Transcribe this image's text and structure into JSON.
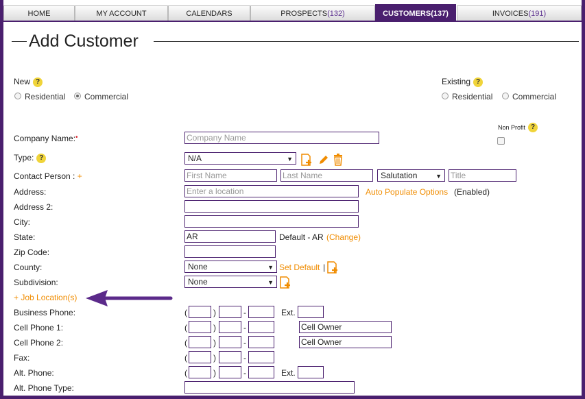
{
  "nav": {
    "tabs": [
      {
        "label": "HOME",
        "count": ""
      },
      {
        "label": "MY ACCOUNT",
        "count": ""
      },
      {
        "label": "CALENDARS",
        "count": ""
      },
      {
        "label": "PROSPECTS",
        "count": "(132)"
      },
      {
        "label": "CUSTOMERS",
        "count": "(137)"
      },
      {
        "label": "INVOICES",
        "count": "(191)"
      }
    ],
    "active": "CUSTOMERS"
  },
  "page": {
    "title": "Add Customer"
  },
  "new_group": {
    "label": "New",
    "residential": "Residential",
    "commercial": "Commercial",
    "selected": "Commercial"
  },
  "existing_group": {
    "label": "Existing",
    "residential": "Residential",
    "commercial": "Commercial"
  },
  "non_profit": {
    "label": "Non Profit"
  },
  "help_icon": "?",
  "form": {
    "company_name": {
      "label": "Company Name:",
      "placeholder": "Company Name"
    },
    "type": {
      "label": "Type:",
      "value": "N/A"
    },
    "contact": {
      "label": "Contact Person :",
      "plus": "+",
      "first_placeholder": "First Name",
      "last_placeholder": "Last Name",
      "salutation": "Salutation",
      "title_placeholder": "Title"
    },
    "address": {
      "label": "Address:",
      "placeholder": "Enter a location",
      "auto_populate": "Auto Populate Options",
      "auto_state": "(Enabled)"
    },
    "address2": {
      "label": "Address 2:"
    },
    "city": {
      "label": "City:"
    },
    "state": {
      "label": "State:",
      "value": "AR",
      "default_text": "Default - AR",
      "change_link": "(Change)"
    },
    "zip": {
      "label": "Zip Code:"
    },
    "county": {
      "label": "County:",
      "value": "None",
      "set_default": "Set Default",
      "separator": "|"
    },
    "subdivision": {
      "label": "Subdivision:",
      "value": "None"
    },
    "job_locations": {
      "label": "+ Job Location(s)"
    },
    "business_phone": {
      "label": "Business Phone:",
      "ext_label": "Ext."
    },
    "cell_phone1": {
      "label": "Cell Phone 1:",
      "owner": "Cell Owner"
    },
    "cell_phone2": {
      "label": "Cell Phone 2:",
      "owner": "Cell Owner"
    },
    "fax": {
      "label": "Fax:"
    },
    "alt_phone": {
      "label": "Alt. Phone:",
      "ext_label": "Ext."
    },
    "alt_phone_type": {
      "label": "Alt. Phone Type:"
    }
  },
  "phone_symbols": {
    "open": "(",
    "close": ")",
    "dash": "-"
  },
  "colors": {
    "brand": "#4a1f6e",
    "accent": "#f08c00",
    "help": "#f0d43a"
  }
}
